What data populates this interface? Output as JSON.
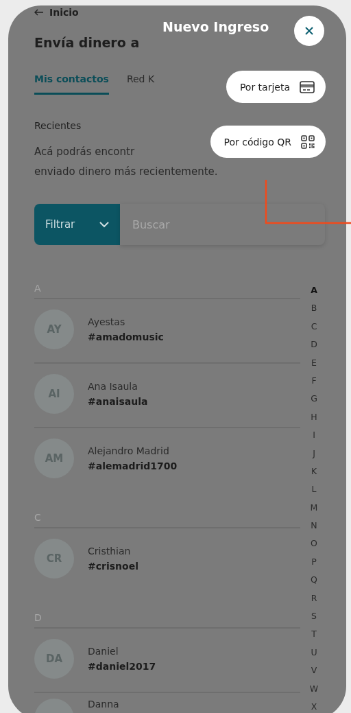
{
  "back": {
    "label": "Inicio"
  },
  "title": "Envía dinero a",
  "tabs": [
    {
      "label": "Mis contactos",
      "selected": true
    },
    {
      "label": "Red K",
      "selected": false
    }
  ],
  "recents": {
    "heading": "Recientes",
    "description_lines": [
      "Acá podrás encontr",
      "enviado dinero más recientemente."
    ]
  },
  "search": {
    "filter_label": "Filtrar",
    "placeholder": "Buscar"
  },
  "sections": [
    {
      "letter": "A",
      "contacts": [
        {
          "initials": "AY",
          "name": "Ayestas",
          "handle": "#amadomusic"
        },
        {
          "initials": "AI",
          "name": "Ana Isaula",
          "handle": "#anaisaula"
        },
        {
          "initials": "AM",
          "name": "Alejandro Madrid",
          "handle": "#alemadrid1700"
        }
      ]
    },
    {
      "letter": "C",
      "contacts": [
        {
          "initials": "CR",
          "name": "Cristhian",
          "handle": "#crisnoel"
        }
      ]
    },
    {
      "letter": "D",
      "contacts": [
        {
          "initials": "DA",
          "name": "Daniel",
          "handle": "#daniel2017"
        },
        {
          "name": "Danna"
        }
      ]
    }
  ],
  "alphabet": [
    {
      "letter": "A",
      "selected": true
    },
    {
      "letter": "B",
      "selected": false
    },
    {
      "letter": "C",
      "selected": false
    },
    {
      "letter": "D",
      "selected": false
    },
    {
      "letter": "E",
      "selected": false
    },
    {
      "letter": "F",
      "selected": false
    },
    {
      "letter": "G",
      "selected": false
    },
    {
      "letter": "H",
      "selected": false
    },
    {
      "letter": "I",
      "selected": false
    },
    {
      "letter": "J",
      "selected": false
    },
    {
      "letter": "K",
      "selected": false
    },
    {
      "letter": "L",
      "selected": false
    },
    {
      "letter": "M",
      "selected": false
    },
    {
      "letter": "N",
      "selected": false
    },
    {
      "letter": "O",
      "selected": false
    },
    {
      "letter": "P",
      "selected": false
    },
    {
      "letter": "Q",
      "selected": false
    },
    {
      "letter": "R",
      "selected": false
    },
    {
      "letter": "S",
      "selected": false
    },
    {
      "letter": "T",
      "selected": false
    },
    {
      "letter": "U",
      "selected": false
    },
    {
      "letter": "V",
      "selected": false
    },
    {
      "letter": "W",
      "selected": false
    },
    {
      "letter": "X",
      "selected": false
    }
  ],
  "overlay": {
    "title": "Nuevo Ingreso",
    "options": [
      {
        "label": "Por tarjeta",
        "kind": "card"
      },
      {
        "label": "Por código QR",
        "kind": "qr"
      }
    ]
  }
}
